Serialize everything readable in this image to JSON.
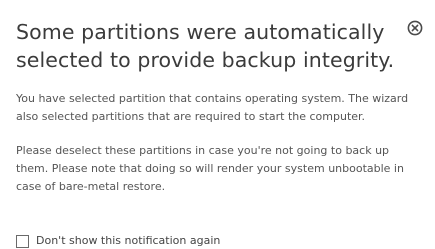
{
  "dialog": {
    "title": "Some partitions were automatically selected to provide backup integrity.",
    "paragraph1": "You have selected partition that contains operating system. The wizard also selected partitions that are required to start the computer.",
    "paragraph2": "Please deselect these partitions in case you're not going to back up them. Please note that doing so will render your system unbootable in case of bare-metal restore.",
    "close_icon": "close-circle-x-icon",
    "checkbox_label": "Don't show this notification again",
    "checkbox_checked": false
  },
  "colors": {
    "title": "#3b3b3b",
    "body_text": "#555555",
    "icon": "#4a4a4a",
    "background": "#ffffff"
  }
}
